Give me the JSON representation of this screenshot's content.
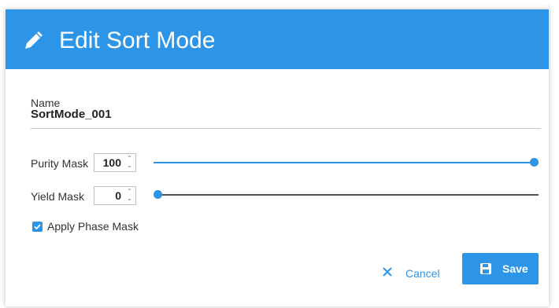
{
  "dialog": {
    "title": "Edit Sort Mode",
    "close_glyph": "×",
    "name_label": "Name",
    "name_value": "SortMode_001",
    "purity": {
      "label": "Purity Mask",
      "value": "100",
      "fraction": 1.0
    },
    "yield": {
      "label": "Yield Mask",
      "value": "0",
      "fraction": 0.0
    },
    "phase_mask": {
      "label": "Apply Phase Mask",
      "checked": true
    },
    "cancel_label": "Cancel",
    "save_label": "Save"
  },
  "colors": {
    "accent": "#2d95e8",
    "header_text": "#ffffff",
    "track_inactive": "#555555"
  },
  "icons": {
    "title_icon": "pencil-icon",
    "cancel_icon": "close-icon",
    "save_icon": "floppy-disk-icon",
    "checkbox_icon": "checkmark-icon"
  }
}
